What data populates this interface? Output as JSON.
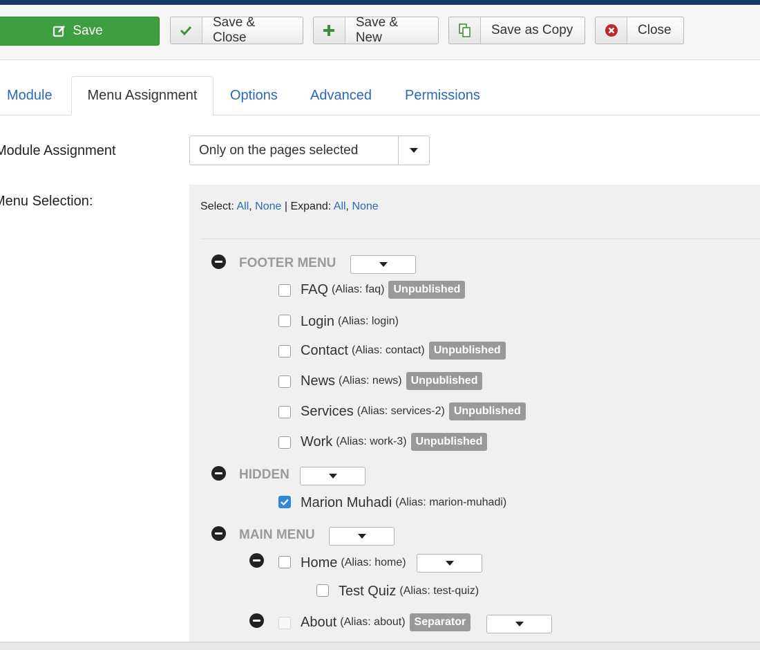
{
  "toolbar": {
    "save": "Save",
    "save_close": "Save & Close",
    "save_new": "Save & New",
    "save_copy": "Save as Copy",
    "close": "Close"
  },
  "tabs": [
    "Module",
    "Menu Assignment",
    "Options",
    "Advanced",
    "Permissions"
  ],
  "active_tab": "Menu Assignment",
  "assignment": {
    "label": "Module Assignment",
    "value": "Only on the pages selected"
  },
  "menu_selection": {
    "label": "Menu Selection:",
    "select_label": "Select:",
    "expand_label": "Expand:",
    "all": "All",
    "none": "None",
    "separator": "|"
  },
  "menus": [
    {
      "title": "FOOTER MENU",
      "items": [
        {
          "name": "FAQ",
          "alias": "(Alias: faq)",
          "badge": "Unpublished",
          "checked": false
        },
        {
          "name": "Login",
          "alias": "(Alias: login)",
          "badge": "",
          "checked": false
        },
        {
          "name": "Contact",
          "alias": "(Alias: contact)",
          "badge": "Unpublished",
          "checked": false
        },
        {
          "name": "News",
          "alias": "(Alias: news)",
          "badge": "Unpublished",
          "checked": false
        },
        {
          "name": "Services",
          "alias": "(Alias: services-2)",
          "badge": "Unpublished",
          "checked": false
        },
        {
          "name": "Work",
          "alias": "(Alias: work-3)",
          "badge": "Unpublished",
          "checked": false
        }
      ]
    },
    {
      "title": "HIDDEN",
      "items": [
        {
          "name": "Marion Muhadi",
          "alias": "(Alias: marion-muhadi)",
          "badge": "",
          "checked": true
        }
      ]
    },
    {
      "title": "MAIN MENU",
      "items": [
        {
          "name": "Home",
          "alias": "(Alias: home)",
          "badge": "",
          "checked": false
        },
        {
          "name": "Test Quiz",
          "alias": "(Alias: test-quiz)",
          "badge": "",
          "checked": false
        },
        {
          "name": "About",
          "alias": "(Alias: about)",
          "badge": "Separator",
          "checked": false
        }
      ]
    }
  ],
  "colors": {
    "accent_link": "#2a69b8",
    "save_green": "#3e9f3e",
    "badge_grey": "#999999",
    "checkbox_blue": "#2f86e0"
  }
}
